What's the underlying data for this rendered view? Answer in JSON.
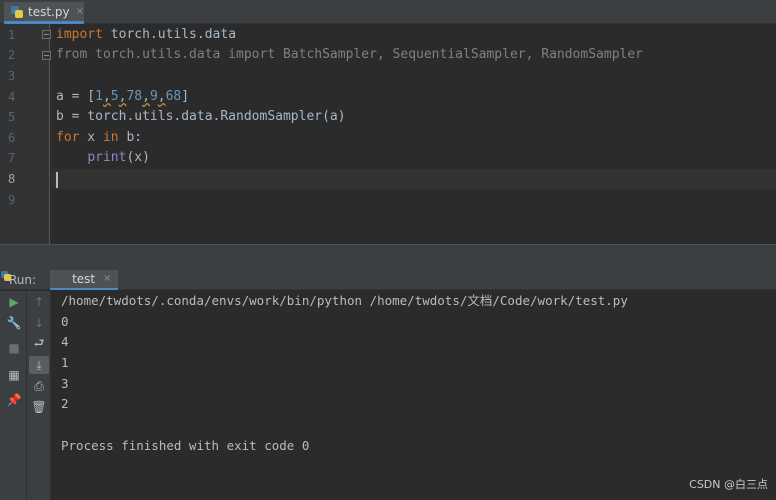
{
  "editor_tab": {
    "label": "test.py",
    "close": "×",
    "icon": "python-file-icon"
  },
  "editor": {
    "line_numbers": [
      "1",
      "2",
      "3",
      "4",
      "5",
      "6",
      "7",
      "8",
      "9"
    ],
    "lines": {
      "l1": {
        "kw": "import",
        "rest": " torch.utils.data"
      },
      "l2": {
        "comment": "from torch.utils.data import BatchSampler, SequentialSampler, RandomSampler"
      },
      "l4": {
        "prefix": "a = [",
        "n1": "1",
        "n2": "5",
        "n3": "78",
        "n4": "9",
        "n5": "68",
        "comma": ",",
        "suffix": "]"
      },
      "l5": {
        "text": "b = torch.utils.data.RandomSampler(a)"
      },
      "l6": {
        "kw1": "for",
        "mid1": " x ",
        "kw2": "in",
        "mid2": " b:"
      },
      "l7": {
        "indent": "    ",
        "builtin": "print",
        "args": "(x)"
      }
    }
  },
  "run_panel": {
    "title": "Run:",
    "tab_label": "test",
    "tab_close": "×",
    "toolbar_left": [
      {
        "name": "rerun-icon",
        "glyph": "▶",
        "color": "#59a869"
      },
      {
        "name": "wrench-icon",
        "glyph": "🔧",
        "color": "#bbbbbb"
      },
      {
        "name": "stop-icon",
        "glyph": "■",
        "color": "#6e6e6e"
      },
      {
        "name": "layout-icon",
        "glyph": "▦",
        "color": "#bbbbbb"
      },
      {
        "name": "pin-icon",
        "glyph": "📌",
        "color": "#bbbbbb"
      }
    ],
    "toolbar_right": [
      {
        "name": "up-arrow-icon",
        "glyph": "↑",
        "color": "#6e6e6e"
      },
      {
        "name": "down-arrow-icon",
        "glyph": "↓",
        "color": "#6e6e6e"
      },
      {
        "name": "soft-wrap-icon",
        "glyph": "⮐",
        "color": "#bbbbbb"
      },
      {
        "name": "scroll-to-end-icon",
        "glyph": "⤓",
        "color": "#bbbbbb"
      },
      {
        "name": "print-icon",
        "glyph": "⎙",
        "color": "#bbbbbb"
      },
      {
        "name": "trash-icon",
        "glyph": "🗑",
        "color": "#bbbbbb"
      }
    ],
    "console_lines": [
      "/home/twdots/.conda/envs/work/bin/python /home/twdots/文档/Code/work/test.py",
      "0",
      "4",
      "1",
      "3",
      "2",
      "",
      "Process finished with exit code 0"
    ]
  },
  "watermark": "CSDN @白三点"
}
